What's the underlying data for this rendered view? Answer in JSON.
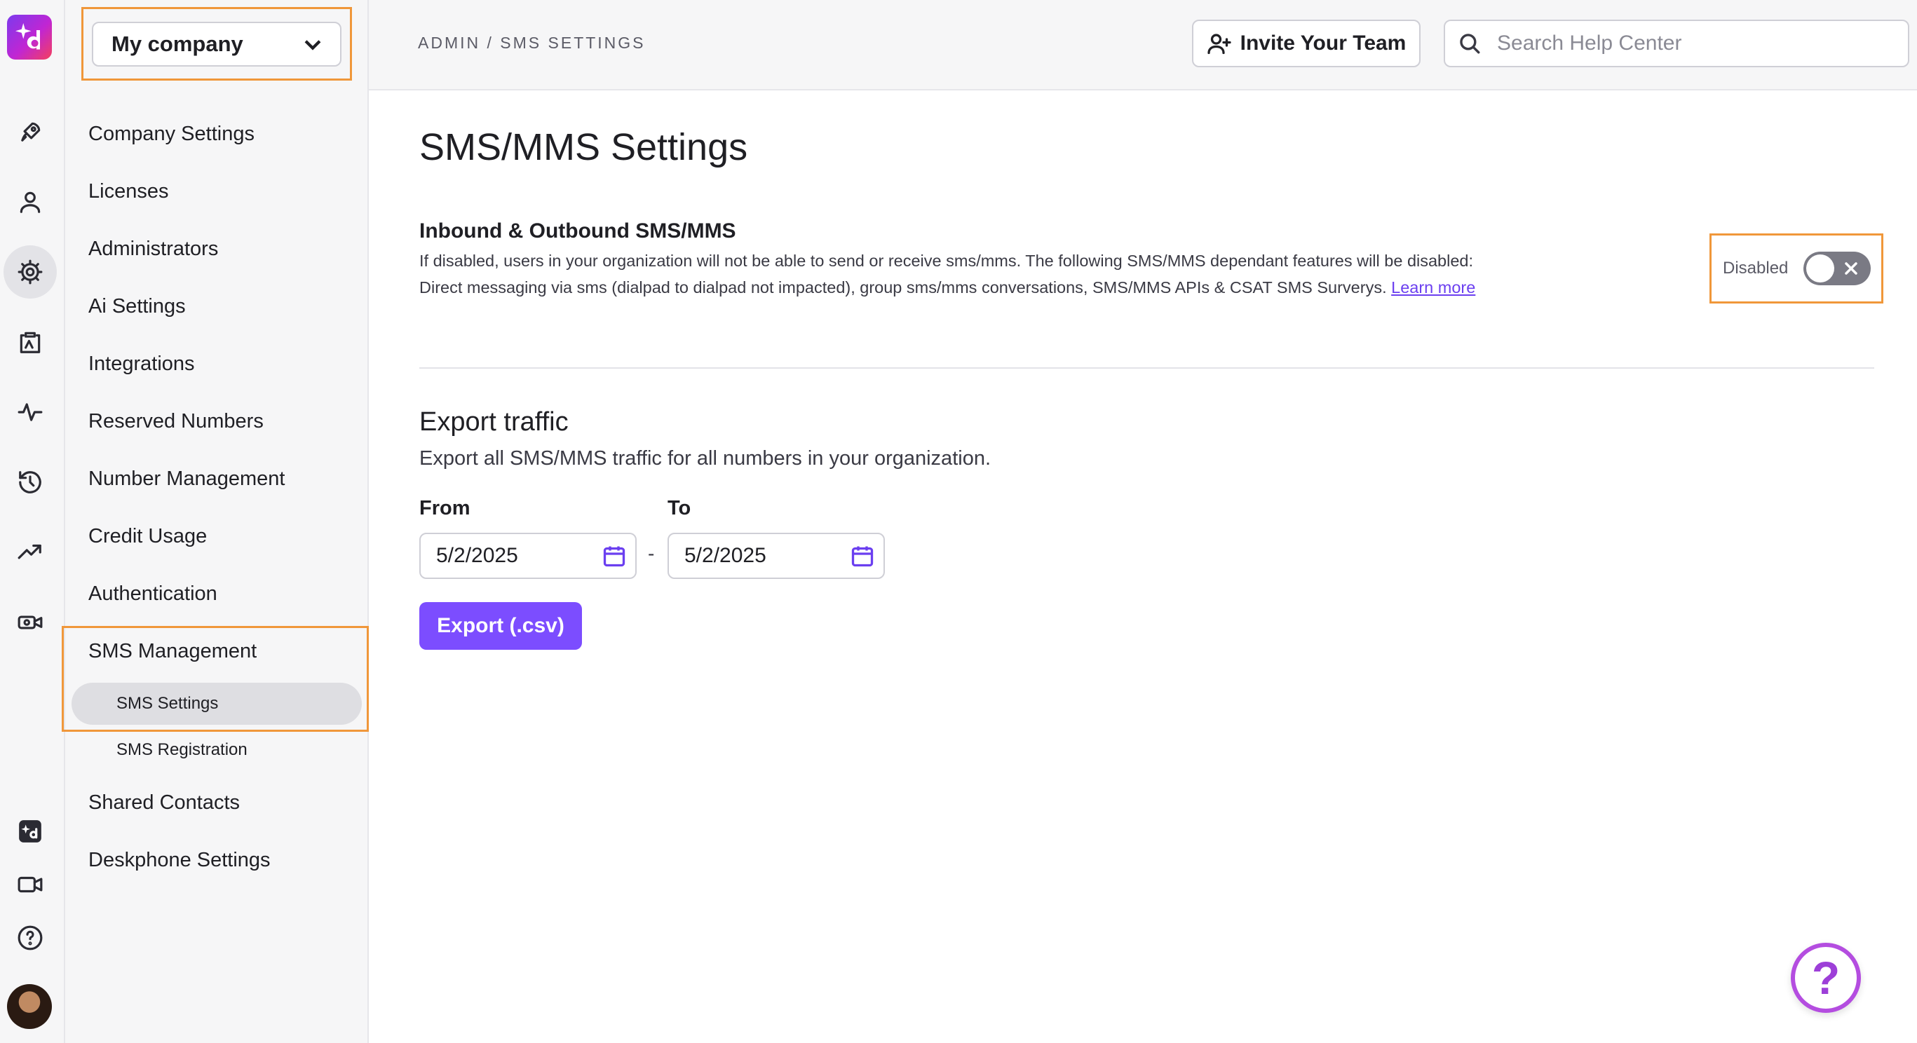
{
  "company_selector": {
    "value": "My company"
  },
  "breadcrumb": "ADMIN / SMS SETTINGS",
  "topbar": {
    "invite_label": "Invite Your Team",
    "search_placeholder": "Search Help Center"
  },
  "sidebar": {
    "items": [
      "Company Settings",
      "Licenses",
      "Administrators",
      "Ai Settings",
      "Integrations",
      "Reserved Numbers",
      "Number Management",
      "Credit Usage",
      "Authentication",
      "SMS Management",
      "Shared Contacts",
      "Deskphone Settings"
    ],
    "sms_sub": [
      "SMS Settings",
      "SMS Registration"
    ]
  },
  "page": {
    "title": "SMS/MMS Settings",
    "inbound": {
      "title": "Inbound & Outbound SMS/MMS",
      "description": "If disabled, users in your organization will not be able to send or receive sms/mms. The following SMS/MMS dependant features will be disabled: Direct messaging via sms (dialpad to dialpad not impacted), group sms/mms conversations, SMS/MMS APIs & CSAT SMS Surverys.",
      "learn_more": "Learn more",
      "toggle_label": "Disabled"
    },
    "export": {
      "title": "Export traffic",
      "description": "Export all SMS/MMS traffic for all numbers in your organization.",
      "from_label": "From",
      "to_label": "To",
      "from_value": "5/2/2025",
      "to_value": "5/2/2025",
      "separator": "-",
      "button_label": "Export (.csv)"
    }
  },
  "help_fab": "?",
  "colors": {
    "accent": "#7c4dff",
    "highlight": "#f0973a",
    "link": "#6b3ff0"
  }
}
